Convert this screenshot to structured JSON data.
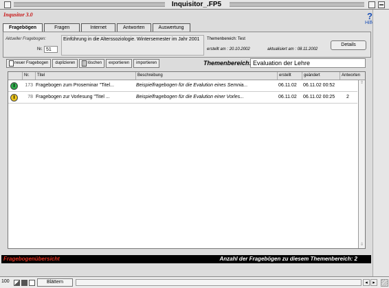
{
  "window": {
    "title": "Inquisitor_.FP5"
  },
  "app": {
    "name": "Inqusitor 3.0",
    "help_label": "Hilfe"
  },
  "tabs": [
    {
      "label": "Fragebögen",
      "active": true
    },
    {
      "label": "Fragen",
      "active": false
    },
    {
      "label": "Internet",
      "active": false
    },
    {
      "label": "Antworten",
      "active": false
    },
    {
      "label": "Auswertung",
      "active": false
    }
  ],
  "current": {
    "label": "Aktueller Fragebogen:",
    "nr_label": "Nr.",
    "nr": "51",
    "description": "Einführung in die Alterssoziologie. Wintersemester im Jahr 2001",
    "theme_label": "Themenbereich:",
    "theme": "Test",
    "created_label": "erstellt am :",
    "created": "20.10.2002",
    "modified_label": "aktualisiert am :",
    "modified": "08.11.2002",
    "detail_button": "Details"
  },
  "toolbar": {
    "new": "neuer Fragebogen",
    "duplicate": "duplizieren",
    "delete": "löschen",
    "export": "exportieren",
    "import": "importieren"
  },
  "theme_filter": {
    "label": "Themenbereich:",
    "value": "Evaluation der Lehre"
  },
  "table": {
    "headers": {
      "nr": "Nr.",
      "title": "Titel",
      "desc": "Beschreibung",
      "created": "erstellt",
      "modified": "geändert",
      "answers": "Antworten"
    },
    "rows": [
      {
        "status": "I",
        "status_color": "#2fa84a",
        "nr": "173",
        "title": "Fragebogen zum Proseminar \"Titel...",
        "desc": "Beispielfragebogen für die Evalution eines Semnia...",
        "created": "06.11.02",
        "modified": "06.11.02 00:52",
        "answers": ""
      },
      {
        "status": "I",
        "status_color": "#e8c21a",
        "nr": "78",
        "title": "Fragebogen zur Vorlesung \"Titel ...",
        "desc": "Beispielfragebogen für die Evalution einer Vorles...",
        "created": "06.11.02",
        "modified": "06.11.02 00:25",
        "answers": "2"
      }
    ]
  },
  "footer": {
    "section": "Fragebogenübersicht",
    "count_label": "Anzahl der Fragebögen zu diesem Themenbereich:",
    "count": "2"
  },
  "statusbar": {
    "zoom": "100",
    "mode": "Blättern"
  },
  "colors": {
    "accent_red": "#c81414",
    "help_blue": "#1a4fb5",
    "footer_bg": "#000000"
  }
}
